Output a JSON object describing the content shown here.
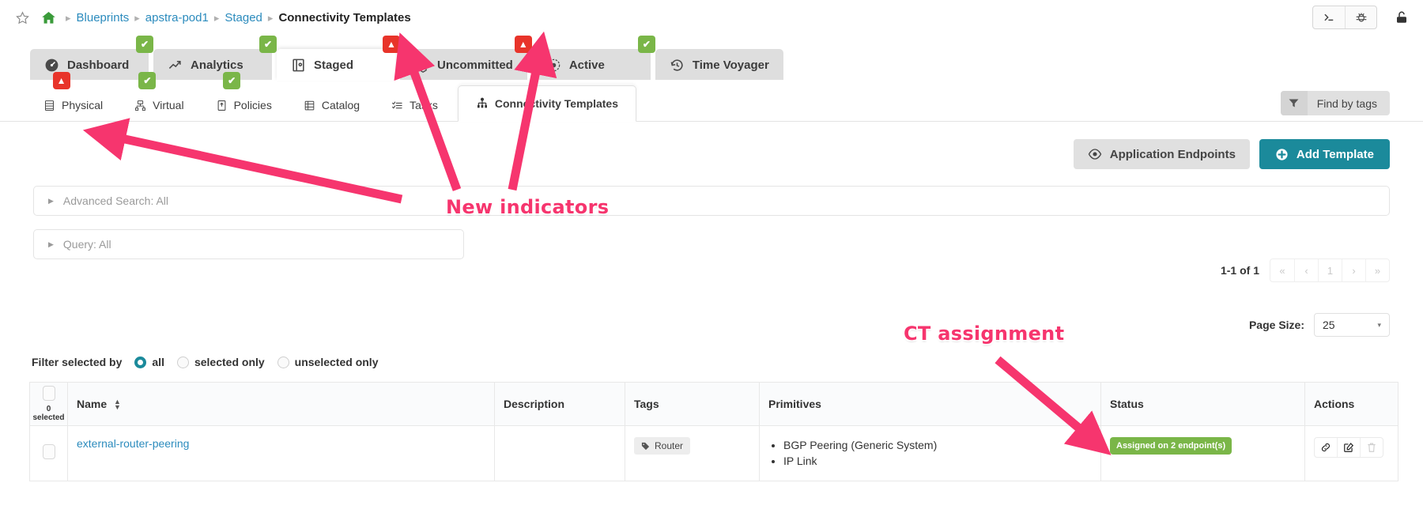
{
  "breadcrumb": {
    "star_icon": "star-icon",
    "home_icon": "home-icon",
    "items": [
      {
        "label": "Blueprints",
        "current": false
      },
      {
        "label": "apstra-pod1",
        "current": false
      },
      {
        "label": "Staged",
        "current": false
      },
      {
        "label": "Connectivity Templates",
        "current": true
      }
    ],
    "separator": "▸"
  },
  "topbar_right": {
    "terminal_icon": ">_",
    "bug_icon": "bug-icon",
    "lock_icon": "unlock-icon"
  },
  "main_tabs": [
    {
      "label": "Dashboard",
      "icon": "dashboard-icon",
      "badge": "ok",
      "badge_glyph": "✔",
      "active": false
    },
    {
      "label": "Analytics",
      "icon": "analytics-icon",
      "badge": "ok",
      "badge_glyph": "✔",
      "active": false
    },
    {
      "label": "Staged",
      "icon": "staged-icon",
      "badge": "warn",
      "badge_glyph": "▲",
      "active": true
    },
    {
      "label": "Uncommitted",
      "icon": "uncommitted-icon",
      "badge": "warn",
      "badge_glyph": "▲",
      "active": false
    },
    {
      "label": "Active",
      "icon": "active-icon",
      "badge": "ok",
      "badge_glyph": "✔",
      "active": false
    },
    {
      "label": "Time Voyager",
      "icon": "time-voyager-icon",
      "badge": null,
      "badge_glyph": "",
      "active": false
    }
  ],
  "sub_tabs": [
    {
      "label": "Physical",
      "icon": "rack-icon",
      "badge": "warn",
      "badge_glyph": "▲",
      "active": false
    },
    {
      "label": "Virtual",
      "icon": "virtual-icon",
      "badge": "ok",
      "badge_glyph": "✔",
      "active": false
    },
    {
      "label": "Policies",
      "icon": "policies-icon",
      "badge": "ok",
      "badge_glyph": "✔",
      "active": false
    },
    {
      "label": "Catalog",
      "icon": "catalog-icon",
      "badge": null,
      "badge_glyph": "",
      "active": false
    },
    {
      "label": "Tasks",
      "icon": "tasks-icon",
      "badge": null,
      "badge_glyph": "",
      "active": false
    },
    {
      "label": "Connectivity Templates",
      "icon": "connectivity-templates-icon",
      "badge": null,
      "badge_glyph": "",
      "active": true
    }
  ],
  "find_by_tags": {
    "label": "Find by tags",
    "icon": "filter-icon"
  },
  "actions": {
    "application_endpoints": {
      "label": "Application Endpoints",
      "icon": "eye-icon"
    },
    "add_template": {
      "label": "Add Template",
      "icon": "plus-circle-icon",
      "color": "#1b8a9b"
    }
  },
  "advanced_search": {
    "label": "Advanced Search: All",
    "caret": "▶"
  },
  "query": {
    "label": "Query: All",
    "caret": "▶"
  },
  "pagination": {
    "count_label": "1-1 of 1",
    "buttons": [
      "«",
      "‹",
      "1",
      "›",
      "»"
    ]
  },
  "page_size": {
    "label": "Page Size:",
    "value": "25",
    "caret": "▾"
  },
  "filter_selected": {
    "label": "Filter selected by",
    "options": [
      {
        "label": "all",
        "selected": true
      },
      {
        "label": "selected only",
        "selected": false
      },
      {
        "label": "unselected only",
        "selected": false
      }
    ]
  },
  "table": {
    "select_all_count": "0 selected",
    "columns": [
      {
        "key": "check",
        "label": ""
      },
      {
        "key": "name",
        "label": "Name",
        "sortable": true
      },
      {
        "key": "description",
        "label": "Description"
      },
      {
        "key": "tags",
        "label": "Tags"
      },
      {
        "key": "primitives",
        "label": "Primitives"
      },
      {
        "key": "status",
        "label": "Status"
      },
      {
        "key": "actions",
        "label": "Actions"
      }
    ],
    "rows": [
      {
        "name": "external-router-peering",
        "description": "",
        "tags": [
          "Router"
        ],
        "primitives": [
          "BGP Peering (Generic System)",
          "IP Link"
        ],
        "status": "Assigned on 2 endpoint(s)",
        "status_color": "#7ab648",
        "actions": [
          {
            "name": "link",
            "glyph": "ὑ7",
            "enabled": true
          },
          {
            "name": "edit",
            "glyph": "✎",
            "enabled": true
          },
          {
            "name": "delete",
            "glyph": "Ὕ1",
            "enabled": false
          }
        ]
      }
    ]
  },
  "annotations": [
    {
      "text": "New indicators",
      "color": "#f6356e"
    },
    {
      "text": "CT assignment",
      "color": "#f6356e"
    }
  ]
}
